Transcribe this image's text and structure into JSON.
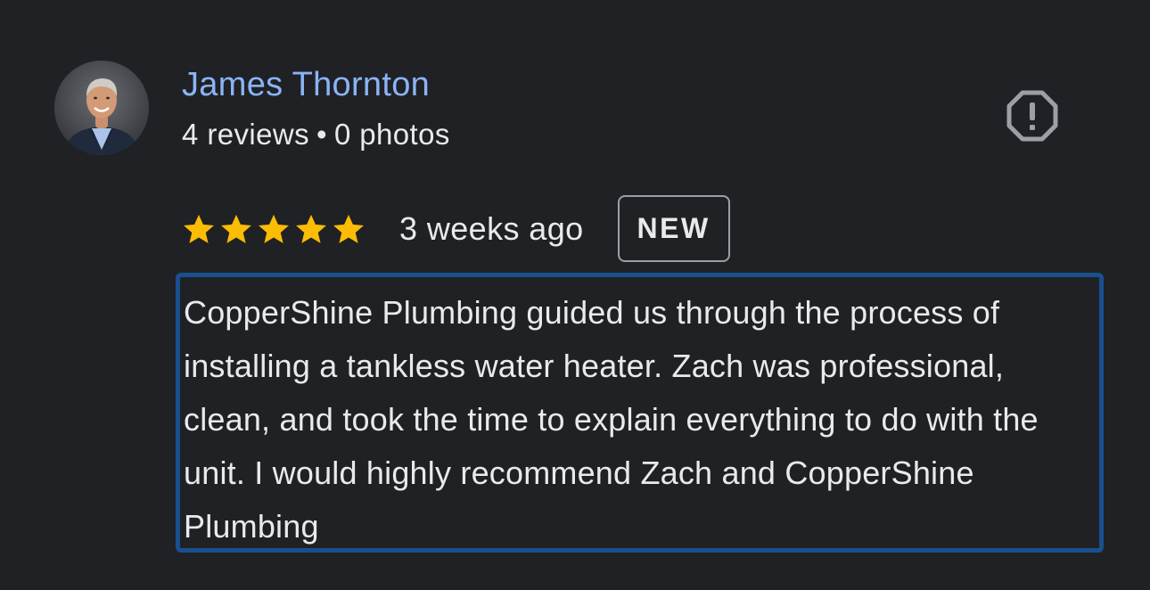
{
  "review": {
    "author": {
      "name": "James Thornton",
      "reviews_count": "4 reviews",
      "separator": "•",
      "photos_count": "0 photos",
      "avatar_icon": "user-profile-photo"
    },
    "report_icon": "report-flag-icon",
    "rating": {
      "stars": 5,
      "max_stars": 5,
      "star_color": "#fbbc04"
    },
    "time_ago": "3 weeks ago",
    "badge": "NEW",
    "text": "CopperShine Plumbing guided us through the process of installing a tankless water heater. Zach was professional, clean, and took the time to explain everything to do with the unit. I would highly recommend Zach and CopperShine Plumbing"
  },
  "colors": {
    "background": "#202124",
    "author_name": "#8ab4f8",
    "text": "#e8eaed",
    "highlight_border": "#1a4f8f"
  }
}
